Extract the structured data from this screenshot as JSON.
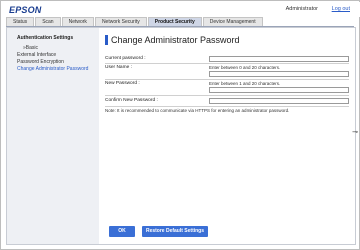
{
  "header": {
    "logo": "EPSON",
    "admin_label": "Administrator",
    "logout_label": "Log out"
  },
  "tabs": [
    {
      "label": "Status"
    },
    {
      "label": "Scan"
    },
    {
      "label": "Network"
    },
    {
      "label": "Network Security"
    },
    {
      "label": "Product Security"
    },
    {
      "label": "Device Management"
    }
  ],
  "active_tab": "Product Security",
  "sidebar": {
    "heading": "Authentication Settings",
    "items": [
      {
        "label": "Basic"
      },
      {
        "label": "External Interface"
      },
      {
        "label": "Password Encryption"
      },
      {
        "label": "Change Administrator Password"
      }
    ]
  },
  "main": {
    "title": "Change Administrator Password",
    "current_password_label": "Current password :",
    "user_name_label": "User Name :",
    "user_name_hint": "Enter between 0 and 20 characters.",
    "new_password_label": "New Password :",
    "new_password_hint": "Enter between 1 and 20 characters.",
    "confirm_password_label": "Confirm New Password :",
    "note": "Note: It is recommended to communicate via HTTPS for entering an administrator password.",
    "current_password_value": "",
    "user_name_value": "",
    "new_password_value": "",
    "confirm_password_value": ""
  },
  "buttons": {
    "ok": "OK",
    "restore": "Restore Default Settings"
  },
  "colors": {
    "accent": "#2a5cc8",
    "button": "#3a6fd6",
    "logo": "#1a3d8f"
  }
}
